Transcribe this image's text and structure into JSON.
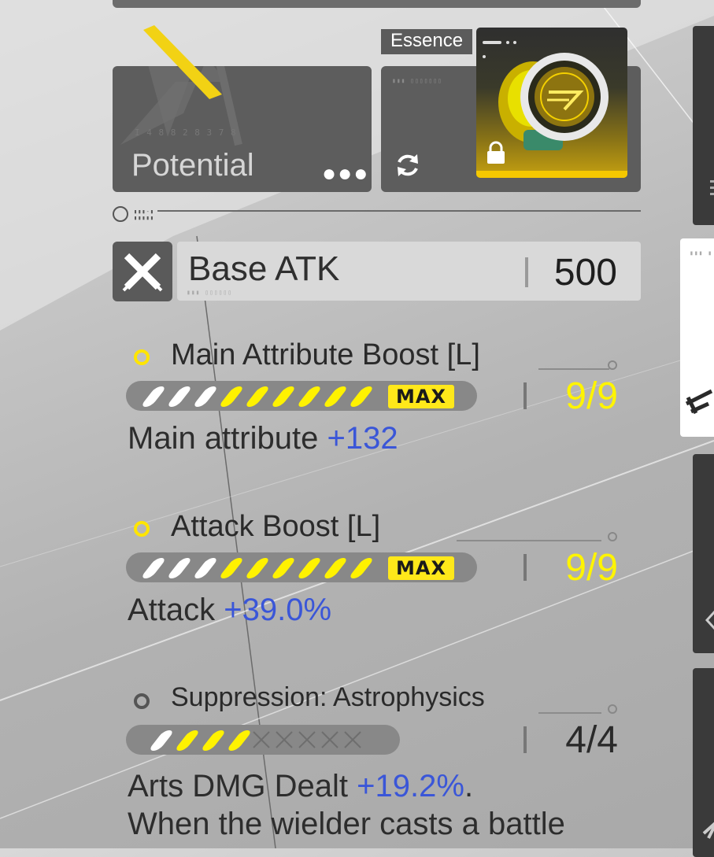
{
  "potential": {
    "label": "Potential",
    "deco_text": "I 4 8 8 2 8 3 7 8",
    "more_icon": "more-dots-icon"
  },
  "essence": {
    "tag": "Essence",
    "locked": true,
    "refresh_icon": "refresh-icon",
    "lock_icon": "lock-icon"
  },
  "base_atk": {
    "label": "Base ATK",
    "value": "500",
    "icon": "crossed-swords-icon"
  },
  "attributes": [
    {
      "name": "Main Attribute Boost [L]",
      "effect_label": "Main attribute",
      "effect_value": "+132",
      "level": "9/9",
      "max_label": "MAX",
      "white_slots": 3,
      "yellow_slots": 6,
      "empty_slots": 0
    },
    {
      "name": "Attack Boost [L]",
      "effect_label": "Attack",
      "effect_value": "+39.0%",
      "level": "9/9",
      "max_label": "MAX",
      "white_slots": 3,
      "yellow_slots": 6,
      "empty_slots": 0
    },
    {
      "name": "Suppression: Astrophysics",
      "effect_label": "Arts DMG Dealt",
      "effect_value": "+19.2%",
      "effect_suffix": ".",
      "effect_line2": "When the wielder casts a battle",
      "level": "4/4",
      "white_slots": 1,
      "yellow_slots": 3,
      "empty_slots": 5
    }
  ],
  "colors": {
    "accent_yellow": "#fff400",
    "value_blue": "#3a56d8",
    "card_grey": "#5d5d5d"
  }
}
